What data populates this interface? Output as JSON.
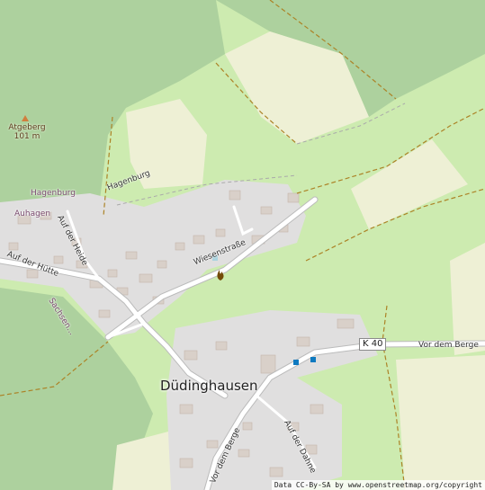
{
  "map": {
    "labels": {
      "village": "Düdinghausen",
      "hamlet1": "Hagenburg",
      "hamlet2": "Auhagen",
      "peak_name": "Atgeberg",
      "peak_elevation": "101 m",
      "road_hagenburg": "Hagenburg",
      "road_wiesen": "Wiesenstraße",
      "road_heide": "Auf der Heide",
      "road_huette": "Auf der Hütte",
      "road_sachsen": "Sachsen...",
      "road_vordemberge_e": "Vor dem Berge",
      "road_vordemberge_s": "Vor dem Berge",
      "road_dahne": "Auf der Dahne",
      "road_ref": "K 40"
    },
    "attribution": "Data CC-By-SA by www.openstreetmap.org/copyright",
    "colors": {
      "forest": "#add19e",
      "meadow": "#cdebb0",
      "farmland": "#eef0d5",
      "residential": "#e0dfdf",
      "building": "#d9d0c9",
      "road": "#ffffff",
      "track": "#ac8327"
    },
    "icons": [
      "peak-icon",
      "fire-icon",
      "water-icon",
      "bus-stop-icon"
    ]
  }
}
